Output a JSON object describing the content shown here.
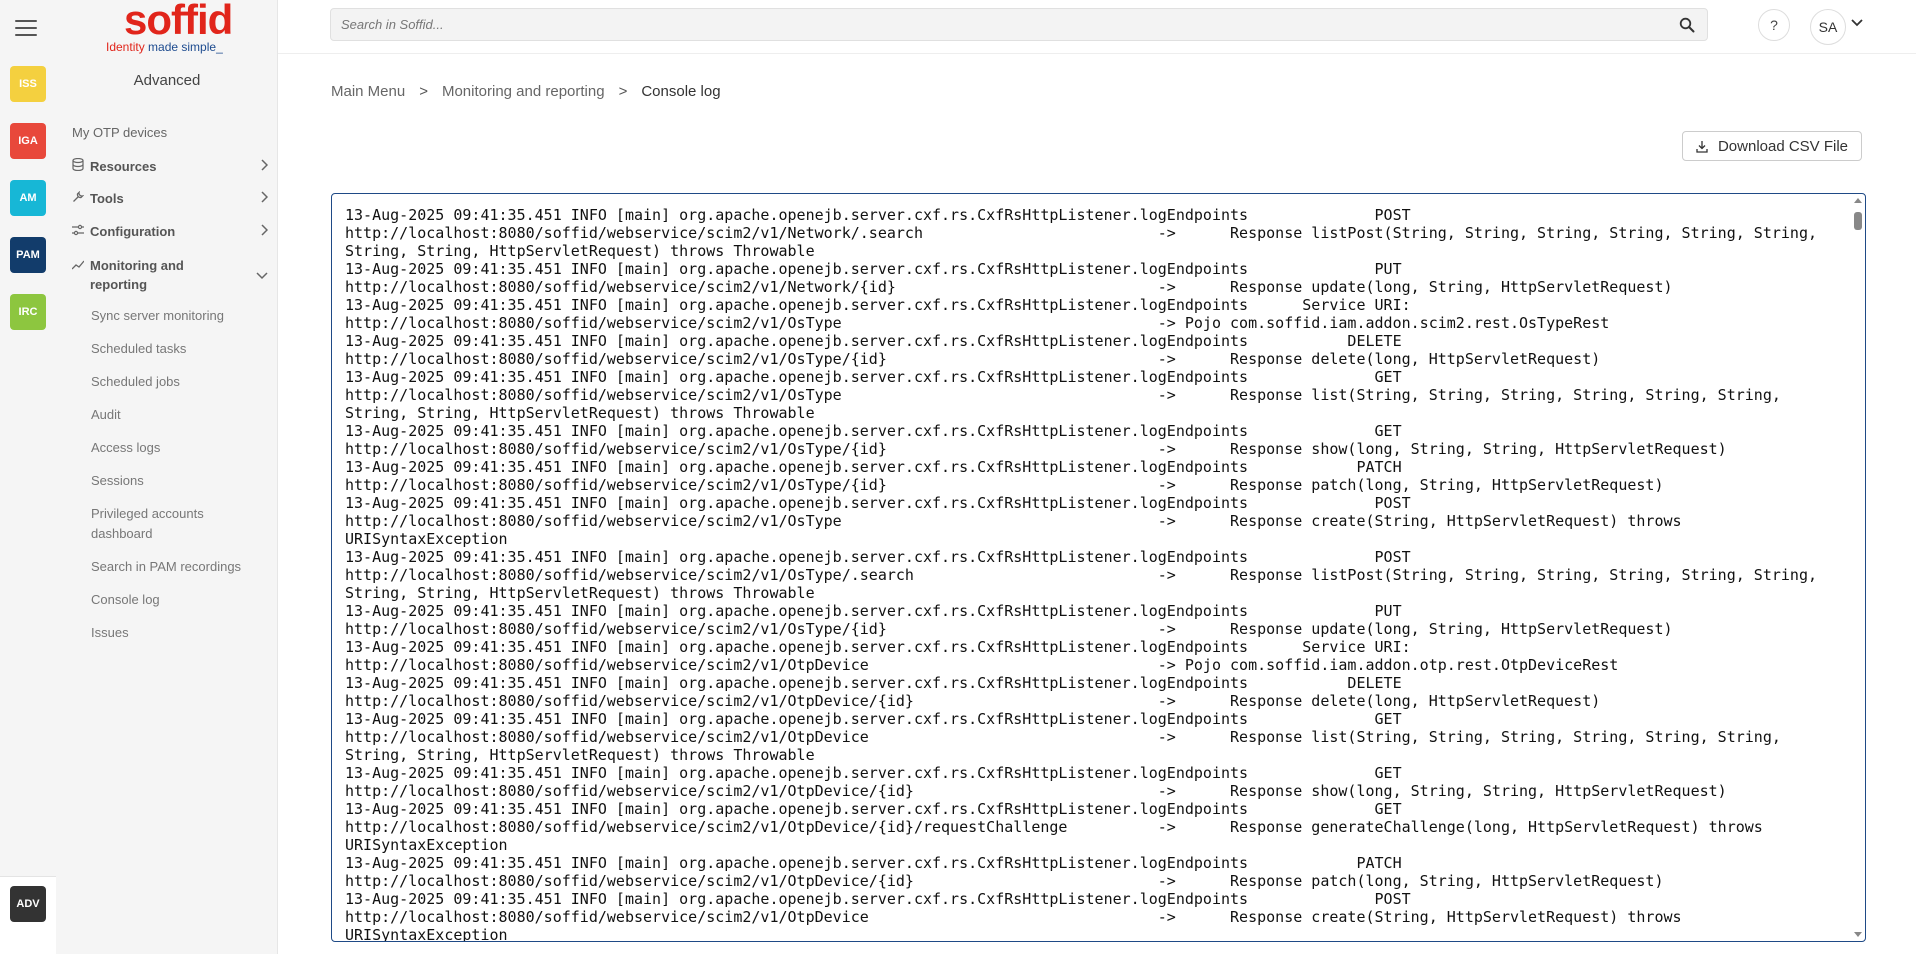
{
  "rail": {
    "apps": [
      {
        "label": "ISS",
        "color": "#f4d03f"
      },
      {
        "label": "IGA",
        "color": "#e8483b"
      },
      {
        "label": "AM",
        "color": "#17b7d6"
      },
      {
        "label": "PAM",
        "color": "#123c6b"
      },
      {
        "label": "IRC",
        "color": "#8dc63f"
      }
    ],
    "bottom_app": {
      "label": "ADV",
      "color": "#333333"
    }
  },
  "logo": {
    "word": "soffid",
    "tag_part1": "Identity",
    "tag_part2": " made simple_"
  },
  "sidenav": {
    "section_title": "Advanced",
    "items": [
      {
        "label": "My OTP devices"
      },
      {
        "label": "Resources",
        "icon": "database-icon"
      },
      {
        "label": "Tools",
        "icon": "wrench-icon"
      },
      {
        "label": "Configuration",
        "icon": "sliders-icon"
      },
      {
        "label": "Monitoring and reporting",
        "icon": "chart-line-icon"
      }
    ],
    "subitems": [
      "Sync server monitoring",
      "Scheduled tasks",
      "Scheduled jobs",
      "Audit",
      "Access logs",
      "Sessions",
      "Privileged accounts dashboard",
      "Search in PAM recordings",
      "Console log",
      "Issues"
    ]
  },
  "topbar": {
    "search_placeholder": "Search in Soffid...",
    "help_label": "?",
    "avatar_initials": "SA"
  },
  "breadcrumb": {
    "items": [
      "Main Menu",
      "Monitoring and reporting",
      "Console log"
    ],
    "separator": ">"
  },
  "download_button": {
    "label": "Download CSV File"
  },
  "console": {
    "lines": [
      "13-Aug-2025 09:41:35.451 INFO [main] org.apache.openejb.server.cxf.rs.CxfRsHttpListener.logEndpoints              POST",
      "http://localhost:8080/soffid/webservice/scim2/v1/Network/.search                          ->      Response listPost(String, String, String, String, String, String,",
      "String, String, HttpServletRequest) throws Throwable",
      "13-Aug-2025 09:41:35.451 INFO [main] org.apache.openejb.server.cxf.rs.CxfRsHttpListener.logEndpoints              PUT",
      "http://localhost:8080/soffid/webservice/scim2/v1/Network/{id}                             ->      Response update(long, String, HttpServletRequest)",
      "13-Aug-2025 09:41:35.451 INFO [main] org.apache.openejb.server.cxf.rs.CxfRsHttpListener.logEndpoints      Service URI:",
      "http://localhost:8080/soffid/webservice/scim2/v1/OsType                                   -> Pojo com.soffid.iam.addon.scim2.rest.OsTypeRest",
      "13-Aug-2025 09:41:35.451 INFO [main] org.apache.openejb.server.cxf.rs.CxfRsHttpListener.logEndpoints           DELETE",
      "http://localhost:8080/soffid/webservice/scim2/v1/OsType/{id}                              ->      Response delete(long, HttpServletRequest)",
      "13-Aug-2025 09:41:35.451 INFO [main] org.apache.openejb.server.cxf.rs.CxfRsHttpListener.logEndpoints              GET",
      "http://localhost:8080/soffid/webservice/scim2/v1/OsType                                   ->      Response list(String, String, String, String, String, String,",
      "String, String, HttpServletRequest) throws Throwable",
      "13-Aug-2025 09:41:35.451 INFO [main] org.apache.openejb.server.cxf.rs.CxfRsHttpListener.logEndpoints              GET",
      "http://localhost:8080/soffid/webservice/scim2/v1/OsType/{id}                              ->      Response show(long, String, String, HttpServletRequest)",
      "13-Aug-2025 09:41:35.451 INFO [main] org.apache.openejb.server.cxf.rs.CxfRsHttpListener.logEndpoints            PATCH",
      "http://localhost:8080/soffid/webservice/scim2/v1/OsType/{id}                              ->      Response patch(long, String, HttpServletRequest)",
      "13-Aug-2025 09:41:35.451 INFO [main] org.apache.openejb.server.cxf.rs.CxfRsHttpListener.logEndpoints              POST",
      "http://localhost:8080/soffid/webservice/scim2/v1/OsType                                   ->      Response create(String, HttpServletRequest) throws",
      "URISyntaxException",
      "13-Aug-2025 09:41:35.451 INFO [main] org.apache.openejb.server.cxf.rs.CxfRsHttpListener.logEndpoints              POST",
      "http://localhost:8080/soffid/webservice/scim2/v1/OsType/.search                           ->      Response listPost(String, String, String, String, String, String,",
      "String, String, HttpServletRequest) throws Throwable",
      "13-Aug-2025 09:41:35.451 INFO [main] org.apache.openejb.server.cxf.rs.CxfRsHttpListener.logEndpoints              PUT",
      "http://localhost:8080/soffid/webservice/scim2/v1/OsType/{id}                              ->      Response update(long, String, HttpServletRequest)",
      "13-Aug-2025 09:41:35.451 INFO [main] org.apache.openejb.server.cxf.rs.CxfRsHttpListener.logEndpoints      Service URI:",
      "http://localhost:8080/soffid/webservice/scim2/v1/OtpDevice                                -> Pojo com.soffid.iam.addon.otp.rest.OtpDeviceRest",
      "13-Aug-2025 09:41:35.451 INFO [main] org.apache.openejb.server.cxf.rs.CxfRsHttpListener.logEndpoints           DELETE",
      "http://localhost:8080/soffid/webservice/scim2/v1/OtpDevice/{id}                           ->      Response delete(long, HttpServletRequest)",
      "13-Aug-2025 09:41:35.451 INFO [main] org.apache.openejb.server.cxf.rs.CxfRsHttpListener.logEndpoints              GET",
      "http://localhost:8080/soffid/webservice/scim2/v1/OtpDevice                                ->      Response list(String, String, String, String, String, String,",
      "String, String, HttpServletRequest) throws Throwable",
      "13-Aug-2025 09:41:35.451 INFO [main] org.apache.openejb.server.cxf.rs.CxfRsHttpListener.logEndpoints              GET",
      "http://localhost:8080/soffid/webservice/scim2/v1/OtpDevice/{id}                           ->      Response show(long, String, String, HttpServletRequest)",
      "13-Aug-2025 09:41:35.451 INFO [main] org.apache.openejb.server.cxf.rs.CxfRsHttpListener.logEndpoints              GET",
      "http://localhost:8080/soffid/webservice/scim2/v1/OtpDevice/{id}/requestChallenge          ->      Response generateChallenge(long, HttpServletRequest) throws",
      "URISyntaxException",
      "13-Aug-2025 09:41:35.451 INFO [main] org.apache.openejb.server.cxf.rs.CxfRsHttpListener.logEndpoints            PATCH",
      "http://localhost:8080/soffid/webservice/scim2/v1/OtpDevice/{id}                           ->      Response patch(long, String, HttpServletRequest)",
      "13-Aug-2025 09:41:35.451 INFO [main] org.apache.openejb.server.cxf.rs.CxfRsHttpListener.logEndpoints              POST",
      "http://localhost:8080/soffid/webservice/scim2/v1/OtpDevice                                ->      Response create(String, HttpServletRequest) throws",
      "URISyntaxException"
    ]
  }
}
